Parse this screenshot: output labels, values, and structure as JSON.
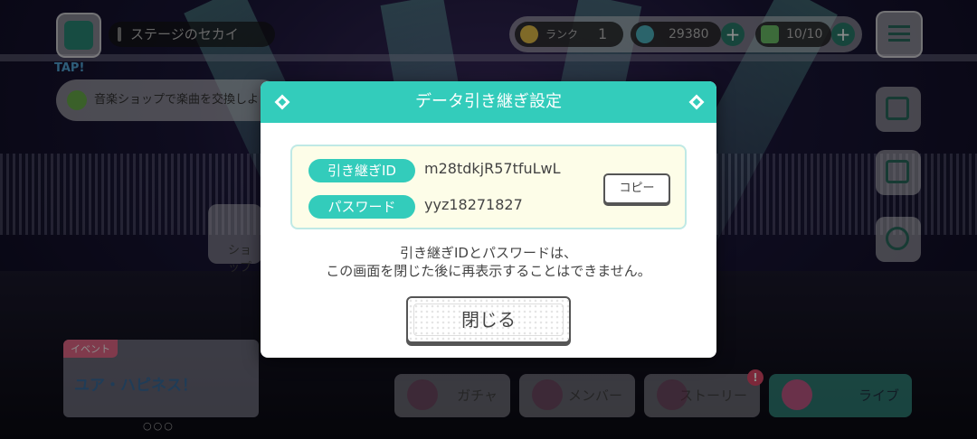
{
  "hud": {
    "world_name": "ステージのセカイ",
    "rank_label": "ランク",
    "rank_value": "1",
    "crystals": "29380",
    "energy": "10/10",
    "tap_label": "TAP!",
    "notice_text": "音楽ショップで楽曲を交換しよう",
    "shop_label": "ショップ"
  },
  "event": {
    "tag": "イベント",
    "title": "ユア・ハピネス！",
    "dots": "○○○"
  },
  "nav": {
    "gacha": "ガチャ",
    "member": "メンバー",
    "story": "ストーリー",
    "story_badge": "!",
    "live": "ライブ"
  },
  "dialog": {
    "title": "データ引き継ぎ設定",
    "id_label": "引き継ぎID",
    "id_value": "m28tdkjR57tfuLwL",
    "password_label": "パスワード",
    "password_value": "yyz18271827",
    "copy_label": "コピー",
    "message_line1": "引き継ぎIDとパスワードは、",
    "message_line2": "この画面を閉じた後に再表示することはできません。",
    "close_label": "閉じる"
  },
  "colors": {
    "accent": "#33ccbb",
    "panel_bg": "#fdfde8",
    "text": "#444444"
  }
}
